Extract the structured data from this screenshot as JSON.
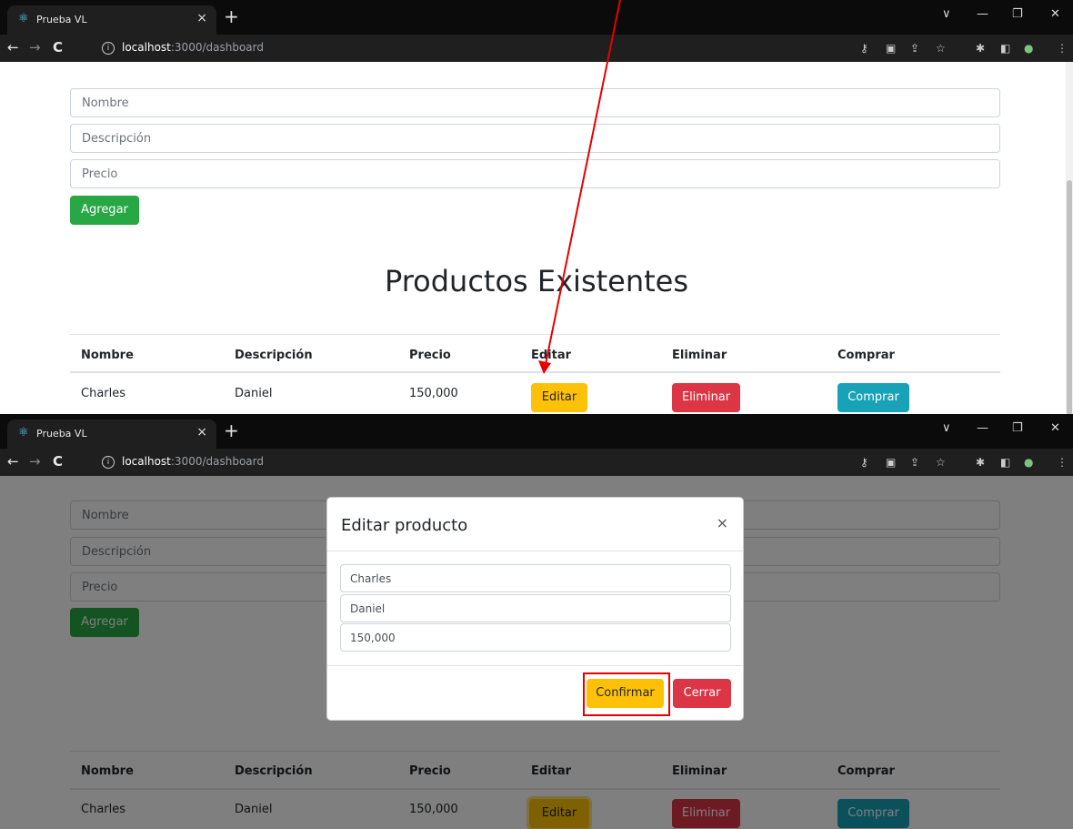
{
  "browser": {
    "tab_title": "Prueba VL",
    "tab_close": "×",
    "new_tab": "+",
    "url_host": "localhost",
    "url_path": ":3000/dashboard",
    "window_controls": [
      "∨",
      "—",
      "❐",
      "✕"
    ]
  },
  "form": {
    "nombre_placeholder": "Nombre",
    "descripcion_placeholder": "Descripción",
    "precio_placeholder": "Precio",
    "add_label": "Agregar"
  },
  "heading": "Productos Existentes",
  "table": {
    "headers": [
      "Nombre",
      "Descripción",
      "Precio",
      "Editar",
      "Eliminar",
      "Comprar"
    ],
    "rows": [
      {
        "nombre": "Charles",
        "descripcion": "Daniel",
        "precio": "150,000",
        "edit_label": "Editar",
        "delete_label": "Eliminar",
        "buy_label": "Comprar"
      }
    ]
  },
  "modal": {
    "title": "Editar producto",
    "close": "×",
    "nombre_value": "Charles",
    "descripcion_value": "Daniel",
    "precio_value": "150,000",
    "confirm_label": "Confirmar",
    "cancel_label": "Cerrar"
  },
  "colors": {
    "success": "#28a745",
    "warning": "#ffc107",
    "danger": "#dc3545",
    "info": "#17a2b8",
    "annotation": "#e60000"
  }
}
